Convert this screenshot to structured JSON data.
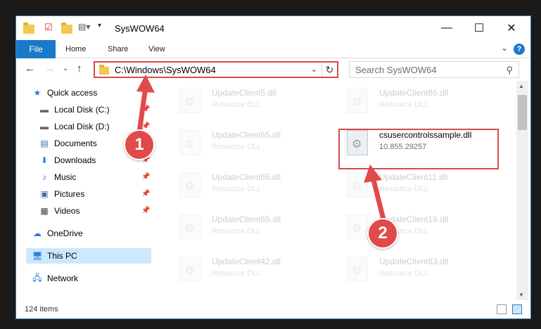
{
  "window": {
    "title": "SysWOW64",
    "controls": {
      "minimize": "—",
      "maximize": "☐",
      "close": "✕"
    }
  },
  "ribbon": {
    "tabs": [
      "File",
      "Home",
      "Share",
      "View"
    ],
    "help": "?"
  },
  "nav": {
    "address": "C:\\Windows\\SysWOW64",
    "search_placeholder": "Search SysWOW64"
  },
  "sidebar": {
    "items": [
      {
        "label": "Quick access",
        "icon": "star-icon"
      },
      {
        "label": "Local Disk (C:)",
        "icon": "drive-icon",
        "pinned": true
      },
      {
        "label": "Local Disk (D:)",
        "icon": "drive-icon",
        "pinned": true
      },
      {
        "label": "Documents",
        "icon": "documents-icon",
        "pinned": true
      },
      {
        "label": "Downloads",
        "icon": "download-icon",
        "pinned": true
      },
      {
        "label": "Music",
        "icon": "music-icon",
        "pinned": true
      },
      {
        "label": "Pictures",
        "icon": "pictures-icon",
        "pinned": true
      },
      {
        "label": "Videos",
        "icon": "videos-icon",
        "pinned": true
      },
      {
        "label": "OneDrive",
        "icon": "cloud-icon"
      },
      {
        "label": "This PC",
        "icon": "computer-icon",
        "selected": true
      },
      {
        "label": "Network",
        "icon": "network-icon"
      }
    ]
  },
  "files": [
    {
      "name": "UpdateClient5.dll",
      "type": "Resource DLL",
      "faded": true
    },
    {
      "name": "UpdateClient65.dll",
      "type": "Resource DLL",
      "faded": true
    },
    {
      "name": "UpdateClient65.dll",
      "type": "Resource DLL",
      "faded": true
    },
    {
      "name": "csusercontrolssample.dll",
      "type": "10.855.29257",
      "faded": false
    },
    {
      "name": "UpdateClient65.dll",
      "type": "Resource DLL",
      "faded": true
    },
    {
      "name": "UpdateClient11.dll",
      "type": "Resource DLL",
      "faded": true
    },
    {
      "name": "UpdateClient65.dll",
      "type": "Resource DLL",
      "faded": true
    },
    {
      "name": "UpdateClient19.dll",
      "type": "Resource DLL",
      "faded": true
    },
    {
      "name": "UpdateClient42.dll",
      "type": "Resource DLL",
      "faded": true
    },
    {
      "name": "UpdateClient63.dll",
      "type": "Resource DLL",
      "faded": true
    }
  ],
  "status": {
    "items": "124 items"
  },
  "callouts": [
    "1",
    "2"
  ],
  "colors": {
    "accent": "#1979ca",
    "callout": "#e04a4a",
    "highlight": "#d94a4a"
  }
}
